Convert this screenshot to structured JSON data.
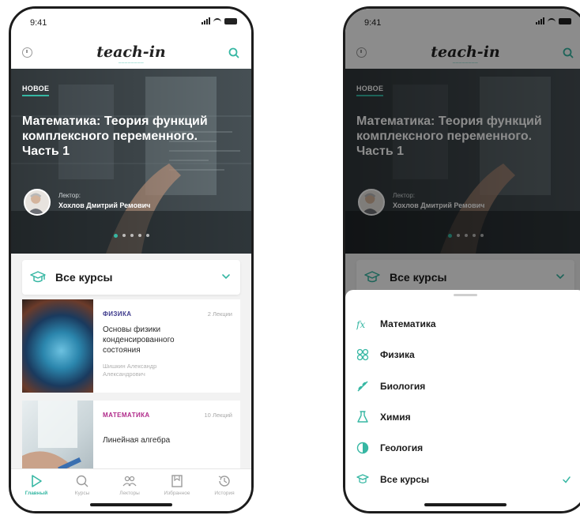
{
  "status": {
    "time": "9:41"
  },
  "header": {
    "logo": "teach-in"
  },
  "hero": {
    "badge": "НОВОЕ",
    "title": "Математика: Теория функций комплексного переменного. Часть 1",
    "lector_label": "Лектор:",
    "lector_name": "Хохлов Дмитрий Ремович",
    "slides": 5,
    "active_slide": 1
  },
  "courses_select": {
    "label": "Все курсы"
  },
  "cards": [
    {
      "subject": "ФИЗИКА",
      "subject_color": "#3d3a8c",
      "lectures": "2 Лекции",
      "title": "Основы физики конденсированного состояния",
      "author": "Шишкин Александр Александрович"
    },
    {
      "subject": "МАТЕМАТИКА",
      "subject_color": "#b02a8a",
      "lectures": "10 Лекций",
      "title": "Линейная алгебра",
      "author": ""
    }
  ],
  "tabs": [
    {
      "label": "Главный",
      "icon": "play-icon",
      "active": true
    },
    {
      "label": "Курсы",
      "icon": "search-icon",
      "active": false
    },
    {
      "label": "Лекторы",
      "icon": "people-icon",
      "active": false
    },
    {
      "label": "Избранное",
      "icon": "bookmark-icon",
      "active": false
    },
    {
      "label": "История",
      "icon": "history-icon",
      "active": false
    }
  ],
  "sheet": {
    "items": [
      {
        "label": "Математика",
        "icon": "math-icon"
      },
      {
        "label": "Физика",
        "icon": "physics-icon"
      },
      {
        "label": "Биология",
        "icon": "biology-icon"
      },
      {
        "label": "Химия",
        "icon": "chemistry-icon"
      },
      {
        "label": "Геология",
        "icon": "geology-icon"
      },
      {
        "label": "Все курсы",
        "icon": "graduation-cap-icon",
        "selected": true
      }
    ]
  },
  "colors": {
    "accent": "#36b7a3",
    "dark": "#1b1b1b"
  }
}
